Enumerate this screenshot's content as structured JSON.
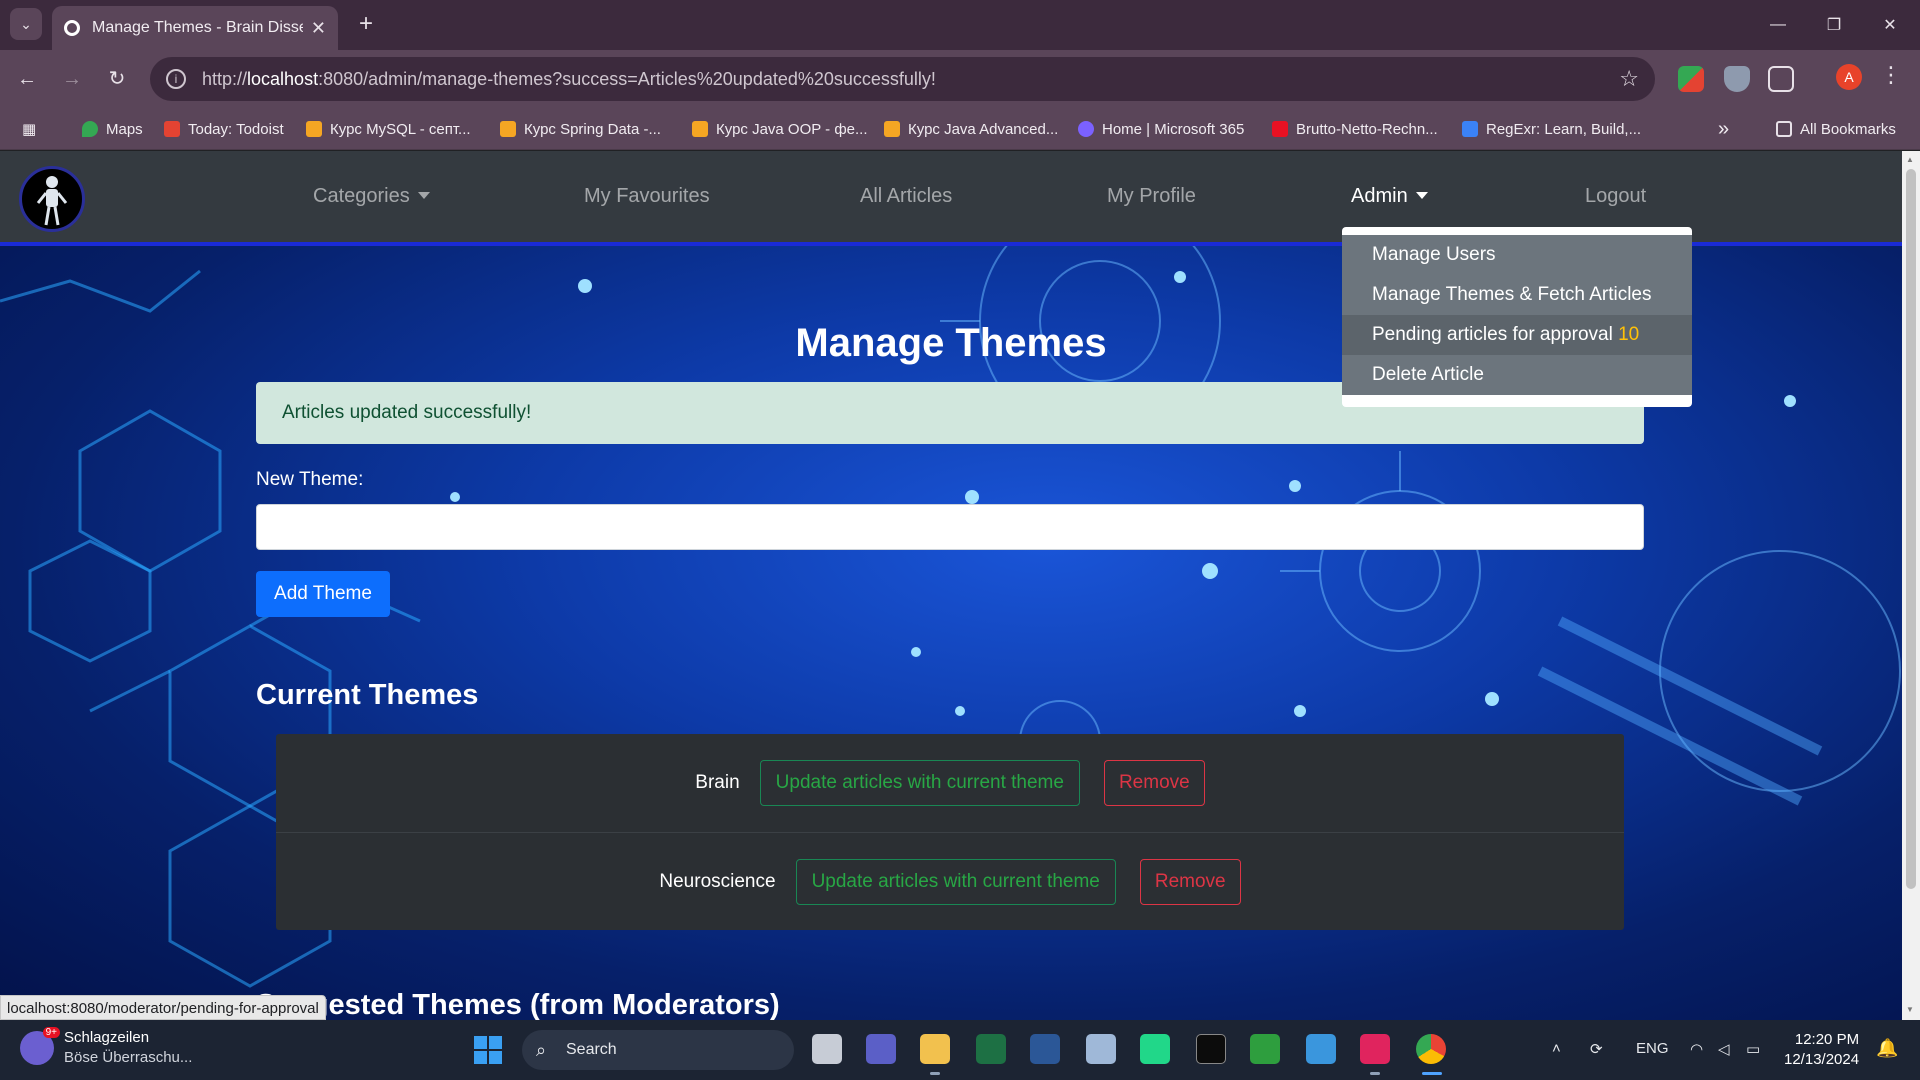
{
  "browser": {
    "tab_title": "Manage Themes - Brain Dissect",
    "tab_close": "✕",
    "new_tab": "+",
    "url_scheme": "http://",
    "url_host": "localhost",
    "url_rest": ":8080/admin/manage-themes?success=Articles%20updated%20successfully!",
    "bookmarks": [
      {
        "label": "Maps",
        "color": "#34a853"
      },
      {
        "label": "Today: Todoist",
        "color": "#e44332"
      },
      {
        "label": "Курс MySQL - септ...",
        "color": "#f5a623"
      },
      {
        "label": "Курс Spring Data -...",
        "color": "#f5a623"
      },
      {
        "label": "Курс Java OOP - фе...",
        "color": "#f5a623"
      },
      {
        "label": "Курс Java Advanced...",
        "color": "#f5a623"
      },
      {
        "label": "Home | Microsoft 365",
        "color": "#7b61ff"
      },
      {
        "label": "Brutto-Netto-Rechn...",
        "color": "#e81123"
      },
      {
        "label": "RegExr: Learn, Build,...",
        "color": "#3b82f6"
      }
    ],
    "bookmarks_overflow": "»",
    "all_bookmarks": "All Bookmarks",
    "profile_initial": "A"
  },
  "navbar": {
    "categories": "Categories",
    "favourites": "My Favourites",
    "all_articles": "All Articles",
    "profile": "My Profile",
    "admin": "Admin",
    "logout": "Logout"
  },
  "admin_menu": {
    "manage_users": "Manage Users",
    "manage_themes": "Manage Themes & Fetch Articles",
    "pending": "Pending articles for approval",
    "pending_count": "10",
    "delete": "Delete Article"
  },
  "page": {
    "title": "Manage Themes",
    "alert": "Articles updated successfully!",
    "new_theme_label": "New Theme:",
    "new_theme_value": "",
    "add_button": "Add Theme",
    "current_title": "Current Themes",
    "themes": [
      {
        "name": "Brain",
        "update_label": "Update articles with current theme",
        "remove_label": "Remove"
      },
      {
        "name": "Neuroscience",
        "update_label": "Update articles with current theme",
        "remove_label": "Remove"
      }
    ],
    "suggested_title": "Suggested Themes (from Moderators)",
    "status_url": "localhost:8080/moderator/pending-for-approval"
  },
  "taskbar": {
    "news_title": "Schlagzeilen",
    "news_sub": "Böse Überraschu...",
    "news_badge": "9+",
    "search": "Search",
    "lang": "ENG",
    "time": "12:20 PM",
    "date": "12/13/2024"
  }
}
